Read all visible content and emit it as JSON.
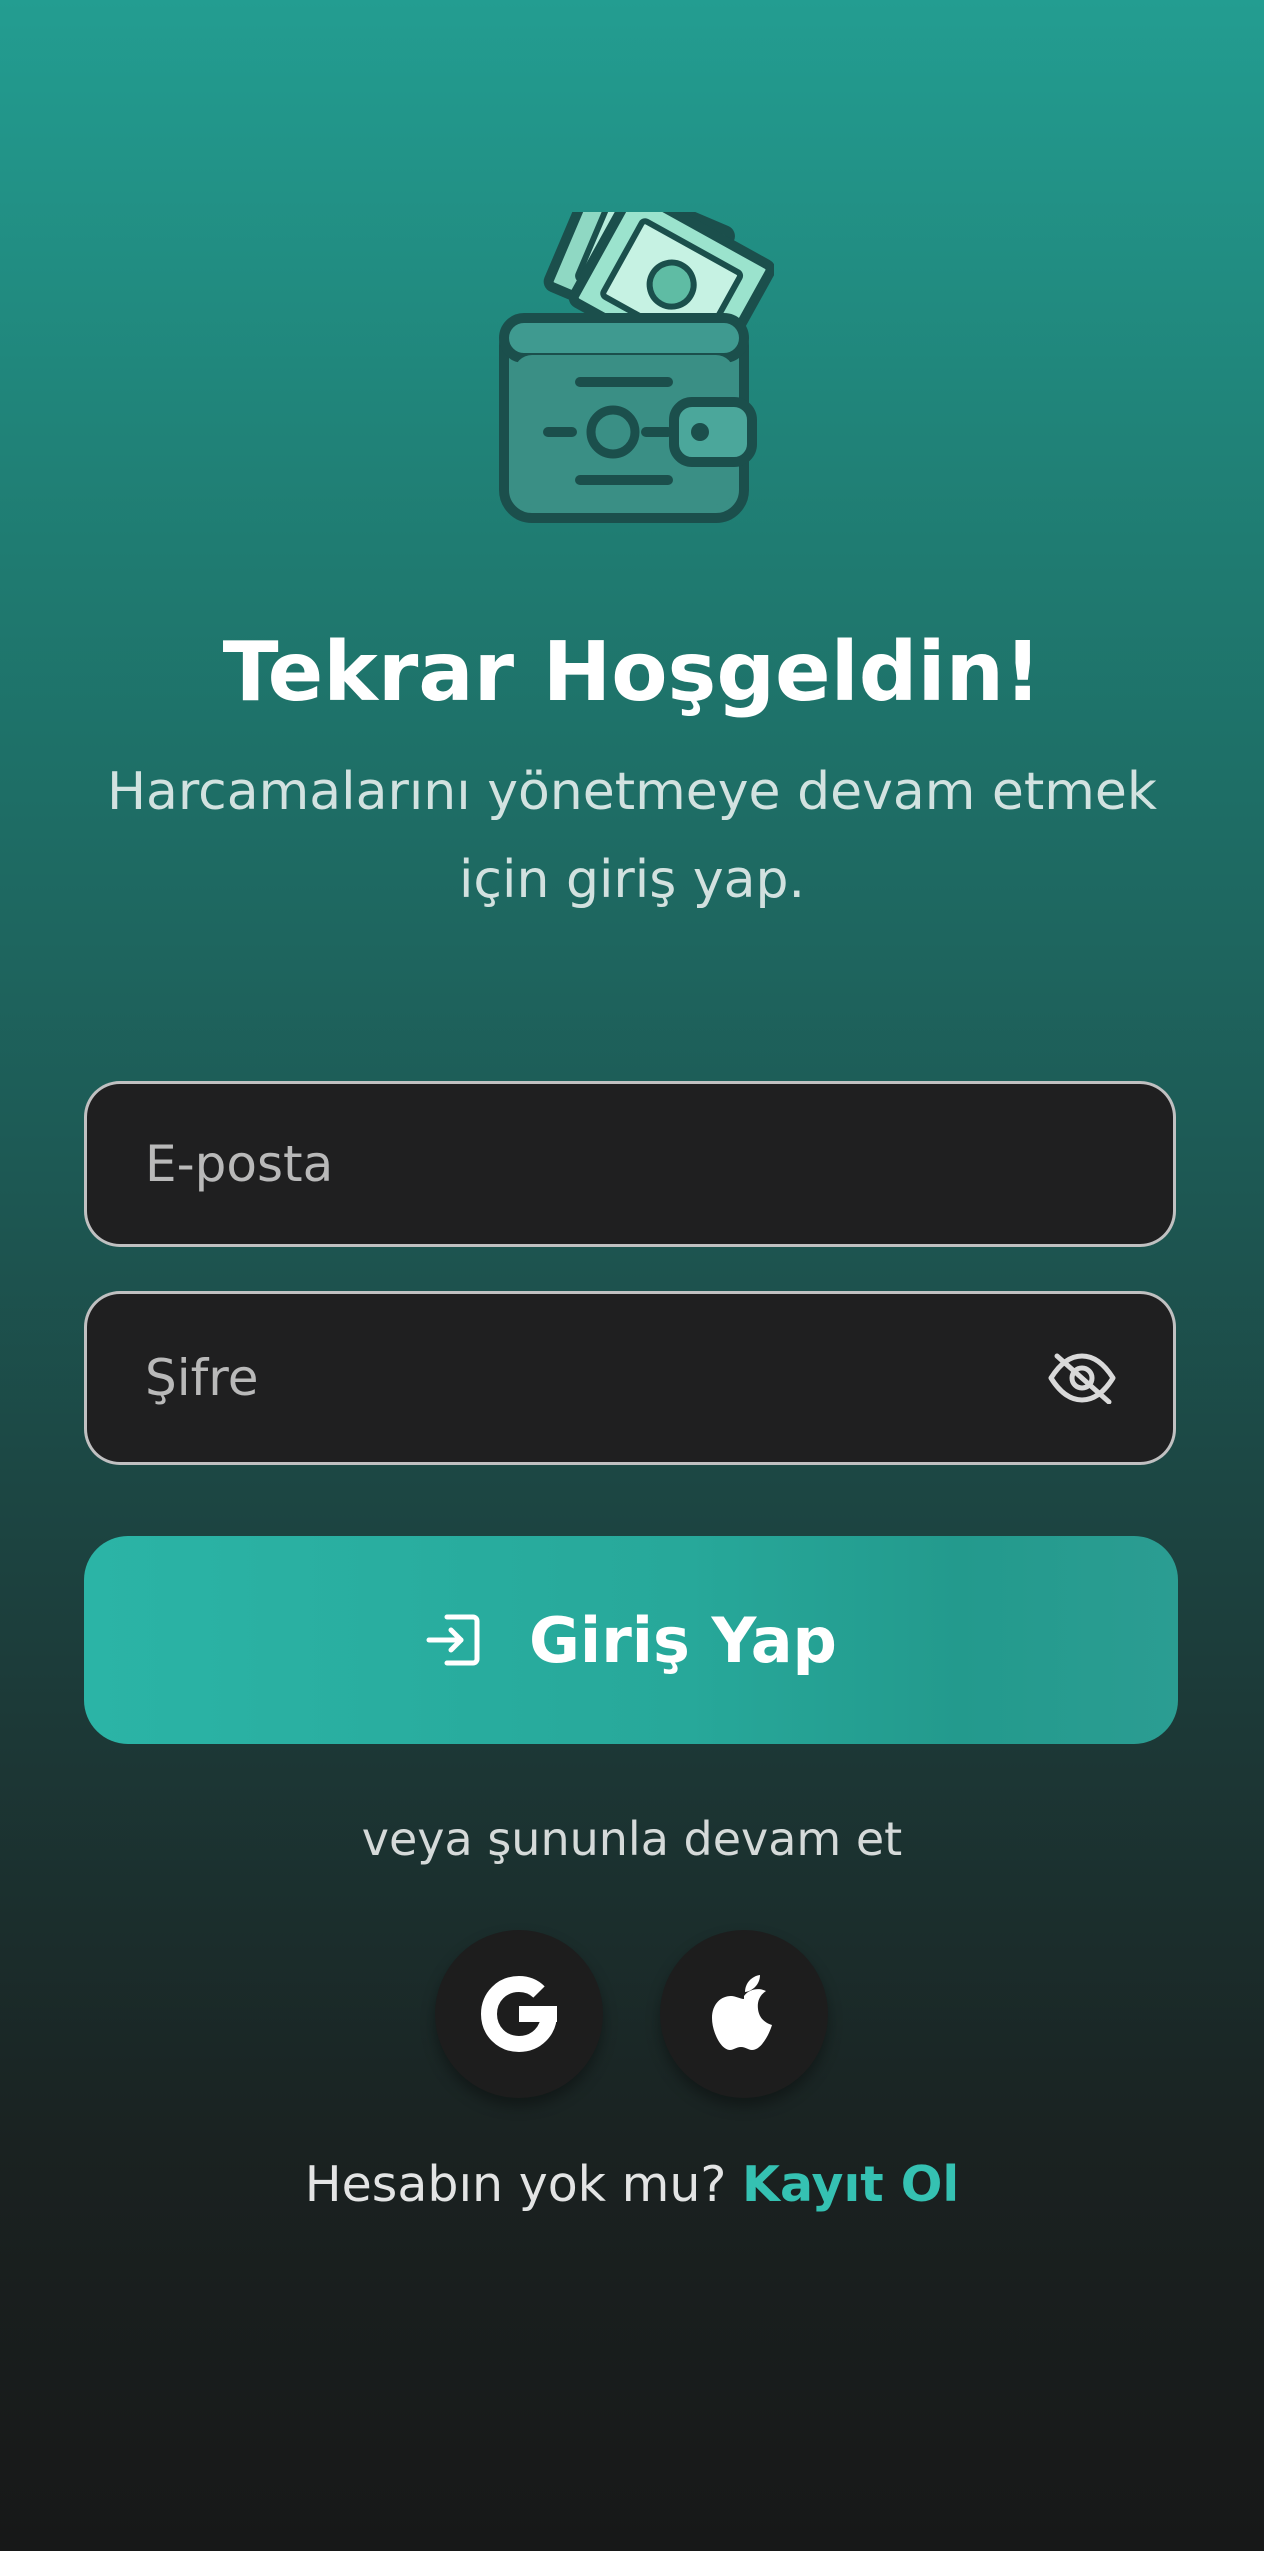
{
  "welcome": {
    "title": "Tekrar Hoşgeldin!",
    "subtitle": "Harcamalarını yönetmeye devam etmek için giriş yap."
  },
  "form": {
    "email_placeholder": "E-posta",
    "password_placeholder": "Şifre",
    "login_button_label": "Giriş Yap"
  },
  "social": {
    "divider_text": "veya şununla devam et",
    "providers": [
      "google",
      "apple"
    ]
  },
  "footer": {
    "prompt": "Hesabın yok mu?",
    "signup_link": "Kayıt Ol"
  },
  "icons": {
    "logo": "wallet-money-icon",
    "password_toggle": "eye-off-icon",
    "login": "login-arrow-icon",
    "google": "google-icon",
    "apple": "apple-icon"
  },
  "colors": {
    "accent": "#2bb4a6",
    "link": "#35c1b2",
    "input_background": "#1f1f20",
    "background_top": "#239d91",
    "background_bottom": "#171818"
  }
}
